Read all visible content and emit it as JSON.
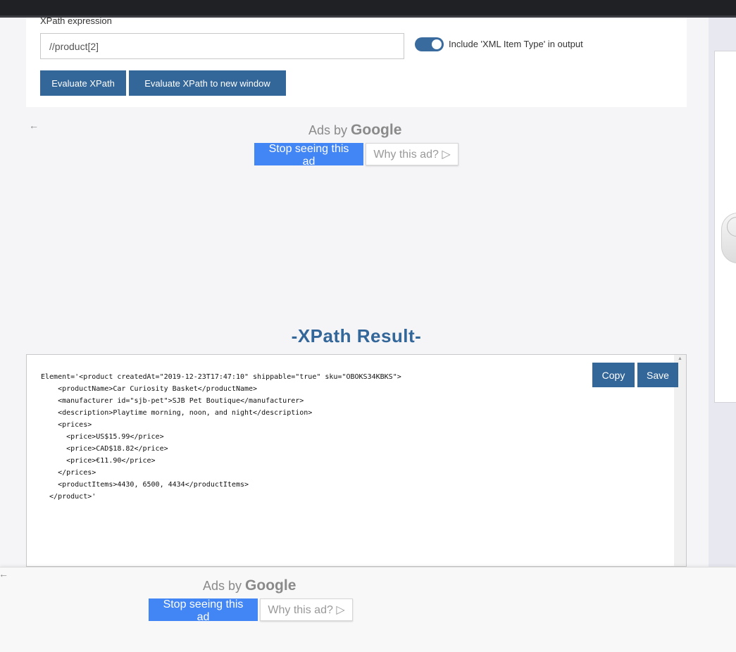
{
  "form": {
    "xpath_label": "XPath expression",
    "xpath_value": "//product[2]",
    "toggle_label": "Include 'XML Item Type' in output",
    "toggle_on": true,
    "evaluate_label": "Evaluate XPath",
    "evaluate_new_window_label": "Evaluate XPath to new window"
  },
  "ad_top": {
    "ads_by": "Ads by",
    "google": "Google",
    "stop_label": "Stop seeing this ad",
    "why_label": "Why this ad?",
    "back_arrow": "←",
    "why_icon": "▷"
  },
  "result": {
    "title": "-XPath Result-",
    "copy_label": "Copy",
    "save_label": "Save",
    "lines": [
      "Element='<product createdAt=\"2019-12-23T17:47:10\" shippable=\"true\" sku=\"OBOKS34KBKS\">",
      "    <productName>Car Curiosity Basket</productName>",
      "    <manufacturer id=\"sjb-pet\">SJB Pet Boutique</manufacturer>",
      "    <description>Playtime morning, noon, and night</description>",
      "    <prices>",
      "      <price>US$15.99</price>",
      "      <price>CAD$18.82</price>",
      "      <price>€11.90</price>",
      "    </prices>",
      "    <productItems>4430, 6500, 4434</productItems>",
      "  </product>'"
    ]
  },
  "ad_bottom": {
    "ads_by": "Ads by",
    "google": "Google",
    "stop_label": "Stop seeing this ad",
    "why_label": "Why this ad?",
    "back_arrow": "←",
    "why_icon": "▷"
  },
  "colors": {
    "primary": "#336699",
    "ad_button": "#4285f4"
  }
}
